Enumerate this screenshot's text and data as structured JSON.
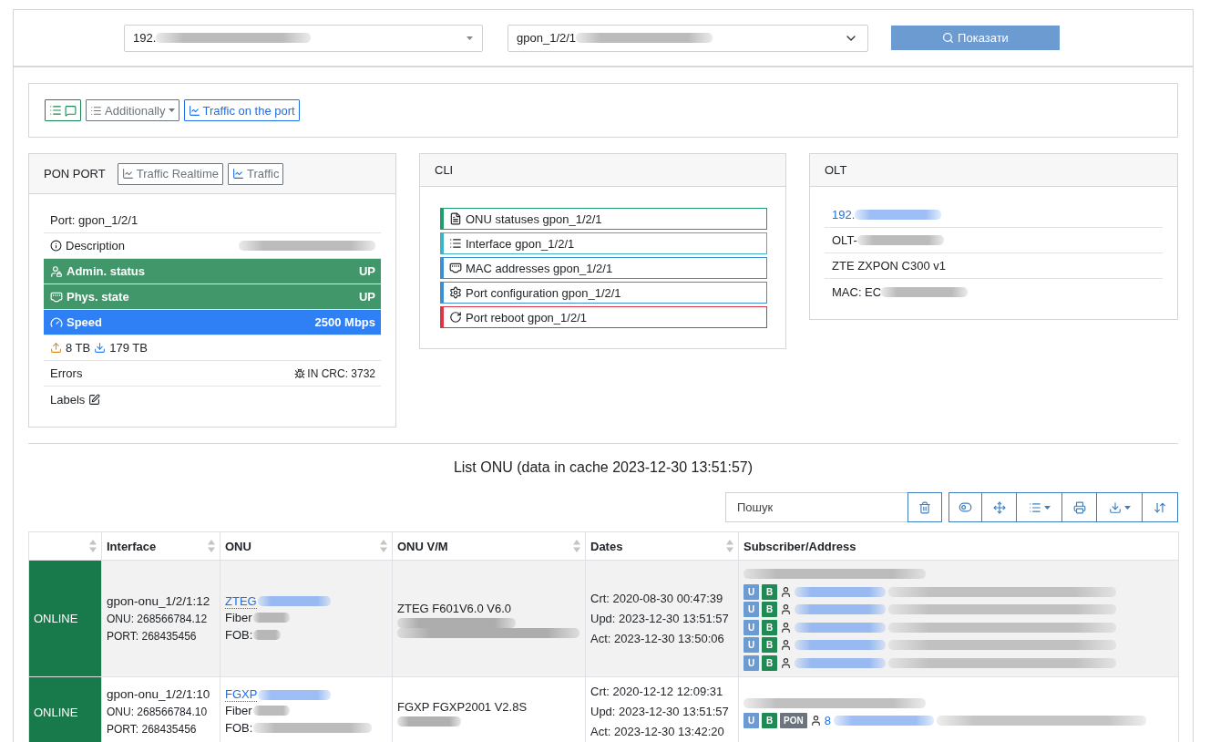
{
  "filters": {
    "olt": {
      "value": "192.",
      "redacted": true
    },
    "port": {
      "value": "gpon_1/2/1",
      "redacted": true
    },
    "show_button": "Показати"
  },
  "toolbar": {
    "additionally": "Additionally",
    "traffic_button": "Traffic on the port"
  },
  "pon_port": {
    "title": "PON PORT",
    "buttons": [
      {
        "label": "Traffic Realtime"
      },
      {
        "label": "Traffic"
      }
    ],
    "rows": [
      {
        "kind": "port",
        "label": "Port: gpon_1/2/1"
      },
      {
        "kind": "description",
        "label": "Description",
        "redacted": true
      },
      {
        "kind": "admin_status",
        "label": "Admin. status",
        "value": "UP",
        "color": "#41976a"
      },
      {
        "kind": "phys_state",
        "label": "Phys. state",
        "value": "UP",
        "color": "#41976a"
      },
      {
        "kind": "speed",
        "label": "Speed",
        "value": "2500 Mbps",
        "color": "#2f7ff5"
      },
      {
        "kind": "traffic",
        "upload": "8 TB",
        "download": "179 TB"
      },
      {
        "kind": "errors",
        "label": "Errors",
        "value": "IN CRC: 3732"
      },
      {
        "kind": "labels",
        "label": "Labels"
      }
    ]
  },
  "cli": {
    "title": "CLI",
    "items": [
      {
        "label": "ONU statuses gpon_1/2/1",
        "color": "#1f9d6b"
      },
      {
        "label": "Interface gpon_1/2/1",
        "color": "#3fb3c4"
      },
      {
        "label": "MAC addresses gpon_1/2/1",
        "color": "#3d8fd1"
      },
      {
        "label": "Port configuration gpon_1/2/1",
        "color": "#3d8fd1"
      },
      {
        "label": "Port reboot gpon_1/2/1",
        "color": "#dc3545"
      }
    ]
  },
  "olt": {
    "title": "OLT",
    "items": [
      {
        "kind": "link",
        "text": "192.",
        "redacted": true
      },
      {
        "kind": "text",
        "text": "OLT-",
        "redacted": true
      },
      {
        "kind": "text",
        "text": "ZTE ZXPON C300 v1",
        "redacted": false
      },
      {
        "kind": "text",
        "text": "MAC: EC",
        "redacted": true
      }
    ]
  },
  "onu_list": {
    "title": "List ONU (data in cache 2023-12-30 13:51:57)",
    "search": {
      "placeholder": "Пошук"
    },
    "columns": [
      {
        "sortable": true
      },
      {
        "label": "Interface",
        "sortable": true
      },
      {
        "label": "ONU",
        "sortable": true
      },
      {
        "label": "ONU V/M",
        "sortable": true
      },
      {
        "label": "Dates",
        "sortable": true
      },
      {
        "label": "Subscriber/Address",
        "sortable": false
      }
    ],
    "rows": [
      {
        "status": {
          "text": "ONLINE",
          "color": "#187a4a"
        },
        "interface": {
          "name": "gpon-onu_1/2/1:12",
          "onu": "ONU: 268566784.12",
          "port": "PORT: 268435456"
        },
        "onu": {
          "serial": "ZTEG",
          "fiber": "Fiber",
          "fob": "FOB:",
          "redacted": true
        },
        "model": {
          "name": "ZTEG F601V6.0 V6.0",
          "hidden_lines": [
            {
              "kind": "medium"
            },
            {
              "kind": "long"
            }
          ]
        },
        "dates": [
          "Crt: 2020-08-30 00:47:39",
          "Upd: 2023-12-30 13:51:57",
          "Act: 2023-12-30 13:50:06"
        ],
        "subscriber": {
          "address_redacted": true,
          "entries": [
            {
              "tags": [
                {
                  "text": "U",
                  "color": "#6b9bd1"
                },
                {
                  "text": "B",
                  "color": "#1f8a53"
                }
              ]
            },
            {
              "tags": [
                {
                  "text": "U",
                  "color": "#6b9bd1"
                },
                {
                  "text": "B",
                  "color": "#1f8a53"
                }
              ]
            },
            {
              "tags": [
                {
                  "text": "U",
                  "color": "#6b9bd1"
                },
                {
                  "text": "B",
                  "color": "#1f8a53"
                }
              ]
            },
            {
              "tags": [
                {
                  "text": "U",
                  "color": "#6b9bd1"
                },
                {
                  "text": "B",
                  "color": "#1f8a53"
                }
              ]
            },
            {
              "tags": [
                {
                  "text": "U",
                  "color": "#6b9bd1"
                },
                {
                  "text": "B",
                  "color": "#1f8a53"
                }
              ]
            }
          ]
        }
      },
      {
        "status": {
          "text": "ONLINE",
          "color": "#187a4a"
        },
        "interface": {
          "name": "gpon-onu_1/2/1:10",
          "onu": "ONU: 268566784.10",
          "port": "PORT: 268435456"
        },
        "onu": {
          "serial": "FGXP",
          "fiber": "Fiber",
          "fob": "FOB:",
          "redacted": true
        },
        "model": {
          "name": "FGXP FGXP2001 V2.8S",
          "hidden_lines": [
            {
              "kind": "short"
            }
          ]
        },
        "dates": [
          "Crt: 2020-12-12 12:09:31",
          "Upd: 2023-12-30 13:51:57",
          "Act: 2023-12-30 13:42:20"
        ],
        "subscriber": {
          "address_redacted": true,
          "entries": [
            {
              "tags": [
                {
                  "text": "U",
                  "color": "#6b9bd1"
                },
                {
                  "text": "B",
                  "color": "#1f8a53"
                },
                {
                  "text": "PON",
                  "color": "#6c757d"
                }
              ],
              "link": "8"
            }
          ]
        }
      }
    ]
  }
}
